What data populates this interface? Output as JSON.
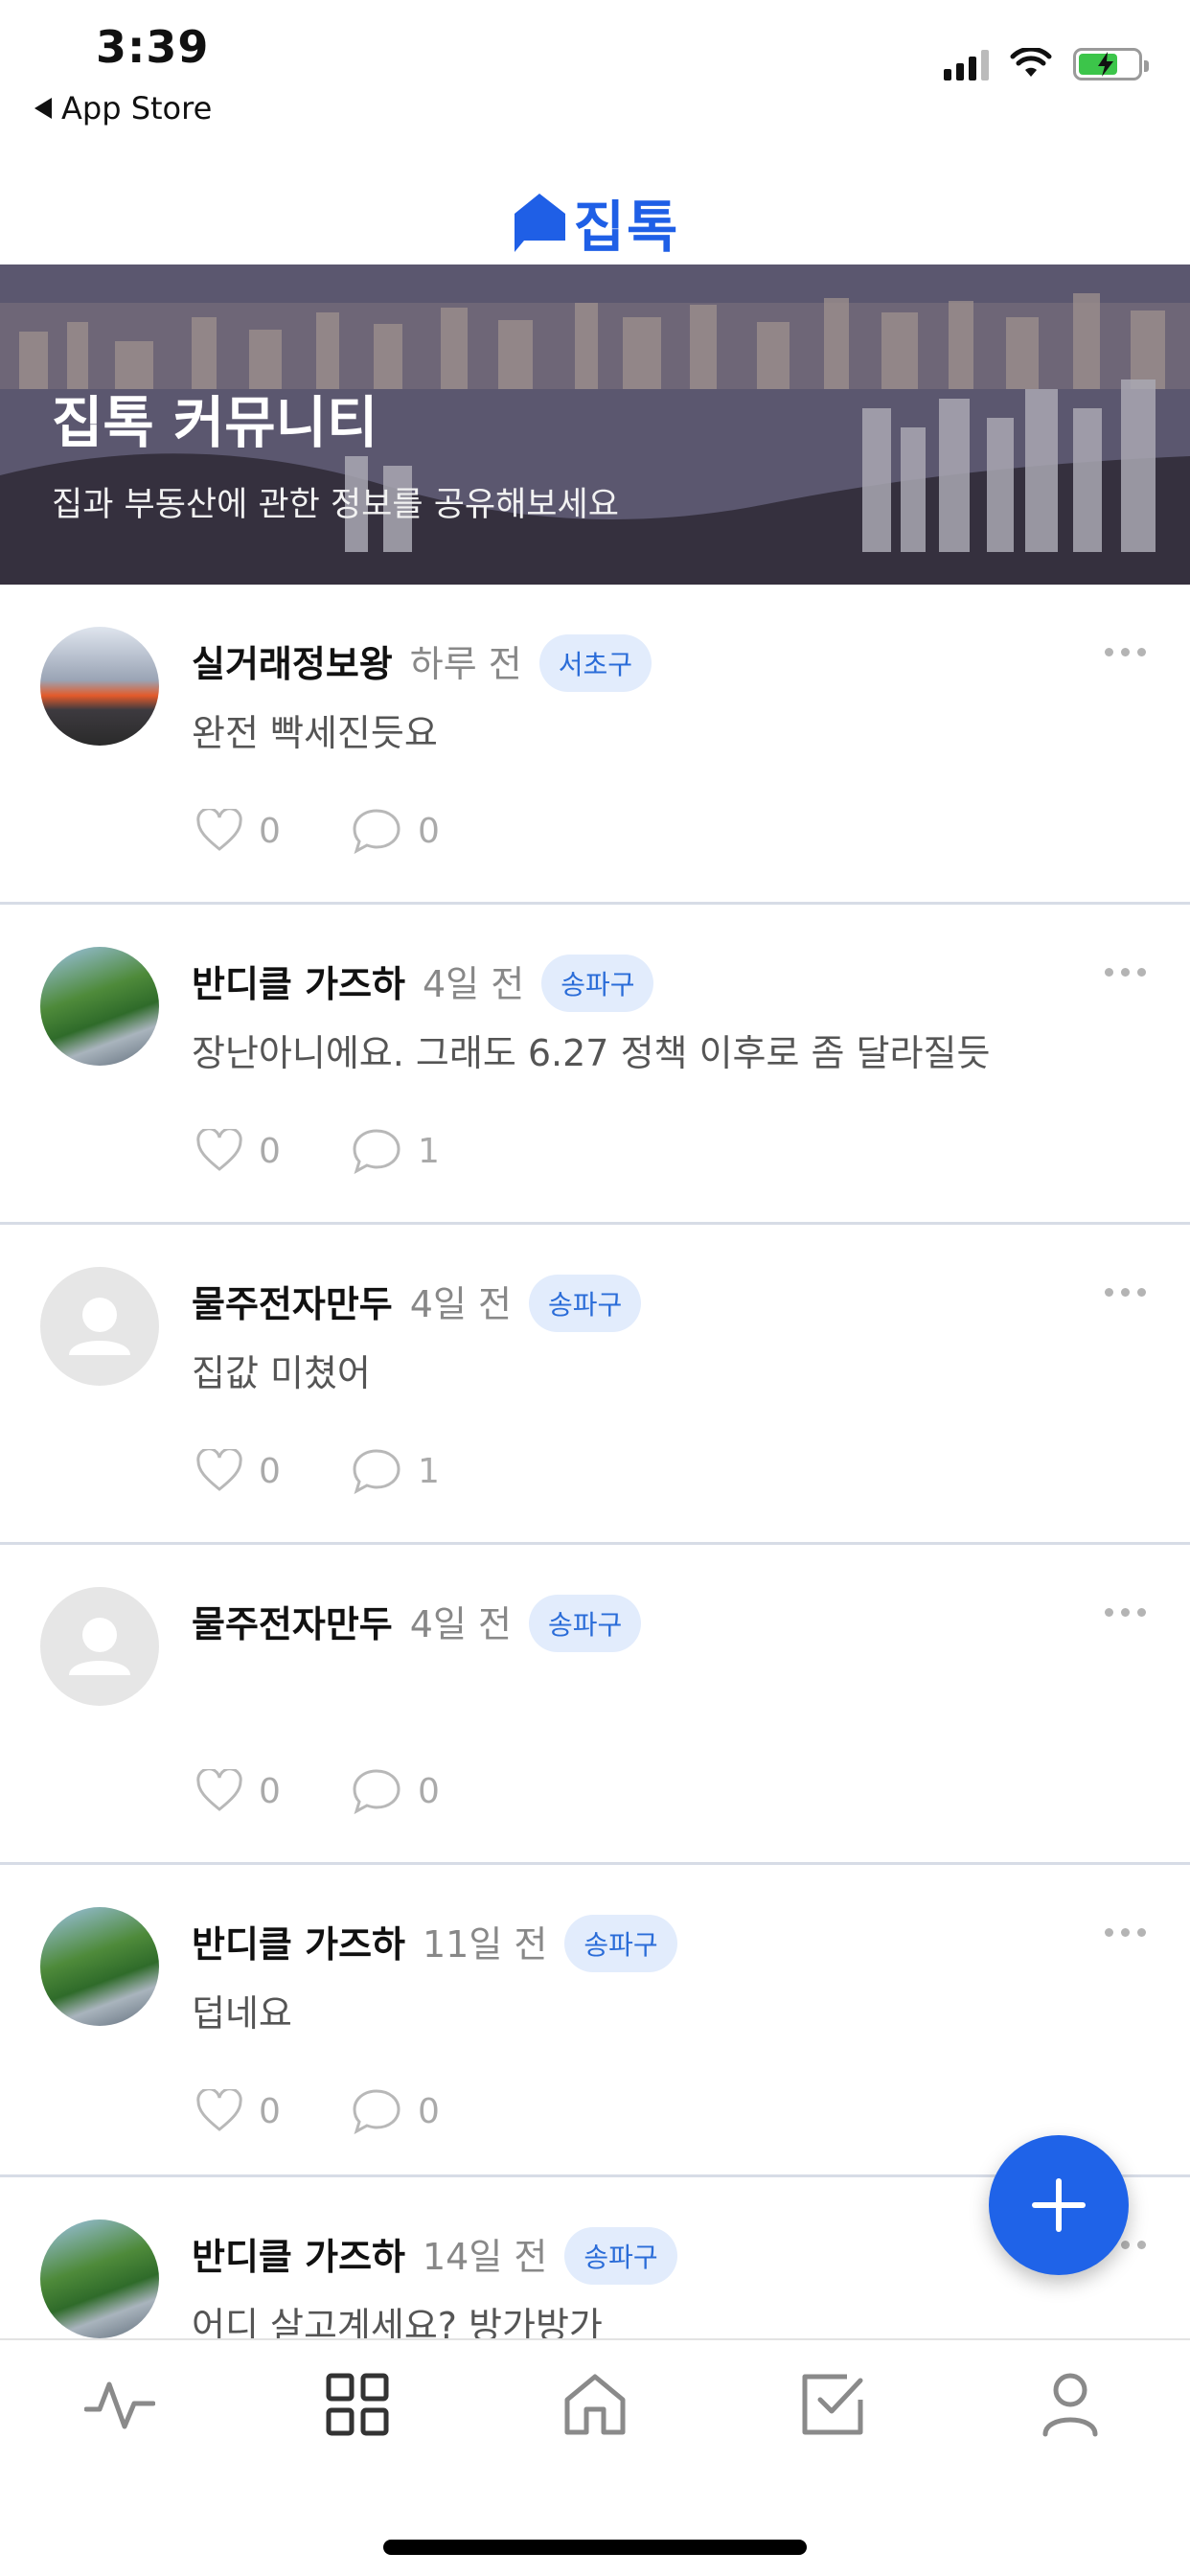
{
  "status_bar": {
    "time": "3:39",
    "back_label": "App Store"
  },
  "header": {
    "logo_text": "집톡",
    "brand_color": "#1f5fe6"
  },
  "banner": {
    "title": "집톡 커뮤니티",
    "subtitle": "집과 부동산에 관한 정보를 공유해보세요"
  },
  "posts": [
    {
      "author": "실거래정보왕",
      "time": "하루 전",
      "region": "서초구",
      "content": "완전 빡세진듯요",
      "likes": "0",
      "comments": "0",
      "avatar": "sunset-photo"
    },
    {
      "author": "반디클 가즈하",
      "time": "4일 전",
      "region": "송파구",
      "content": "장난아니에요. 그래도 6.27 정책 이후로 좀 달라질듯",
      "likes": "0",
      "comments": "1",
      "avatar": "tree-photo"
    },
    {
      "author": "물주전자만두",
      "time": "4일 전",
      "region": "송파구",
      "content": "집값 미쳤어",
      "likes": "0",
      "comments": "1",
      "avatar": "default-avatar"
    },
    {
      "author": "물주전자만두",
      "time": "4일 전",
      "region": "송파구",
      "content": "",
      "likes": "0",
      "comments": "0",
      "avatar": "default-avatar"
    },
    {
      "author": "반디클 가즈하",
      "time": "11일 전",
      "region": "송파구",
      "content": "덥네요",
      "likes": "0",
      "comments": "0",
      "avatar": "tree-photo"
    },
    {
      "author": "반디클 가즈하",
      "time": "14일 전",
      "region": "송파구",
      "content": "어디 살고계세요? 방가방가",
      "likes": "0",
      "comments": "0",
      "avatar": "tree-photo"
    }
  ],
  "tabbar": {
    "items": [
      "activity-icon",
      "grid-icon",
      "home-icon",
      "checklist-icon",
      "profile-icon"
    ],
    "active": "grid-icon"
  }
}
